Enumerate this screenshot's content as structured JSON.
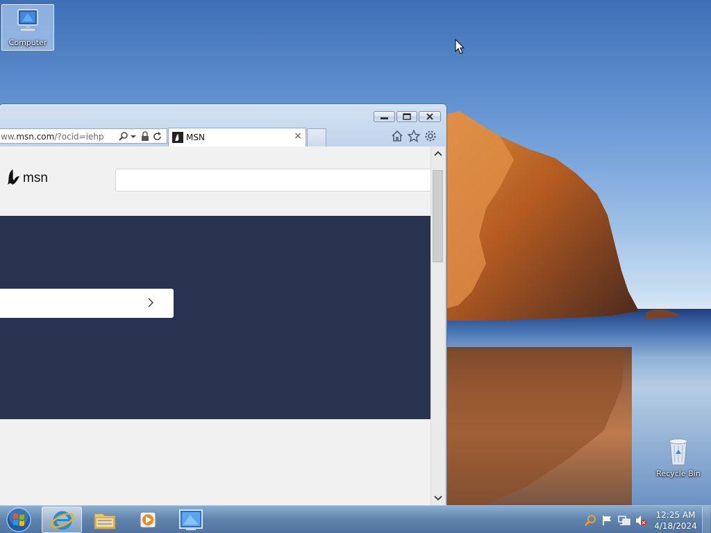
{
  "desktop": {
    "icons": [
      {
        "label": "Computer",
        "icon": "computer-icon"
      },
      {
        "label": "Recycle Bin",
        "icon": "recycle-bin-icon"
      }
    ]
  },
  "browser": {
    "address": {
      "prefix": "ww.",
      "domain": "msn.com",
      "path": "/?ocid=iehp"
    },
    "tab": {
      "title": "MSN",
      "close": "×"
    },
    "page": {
      "logo_text": "msn",
      "search_value": "",
      "hero_button_label": ""
    }
  },
  "taskbar": {
    "apps": [
      "internet-explorer-icon",
      "file-explorer-icon",
      "media-player-icon",
      "remote-desktop-icon"
    ],
    "active_app": "internet-explorer-icon",
    "tray": [
      "search-icon",
      "action-center-flag-icon",
      "network-icon",
      "volume-muted-icon"
    ],
    "clock": {
      "time": "12:25 AM",
      "date": "4/18/2024"
    }
  },
  "colors": {
    "hero_background": "#283350",
    "page_background": "#f1f1f1",
    "taskbar": "#5f82aa"
  }
}
